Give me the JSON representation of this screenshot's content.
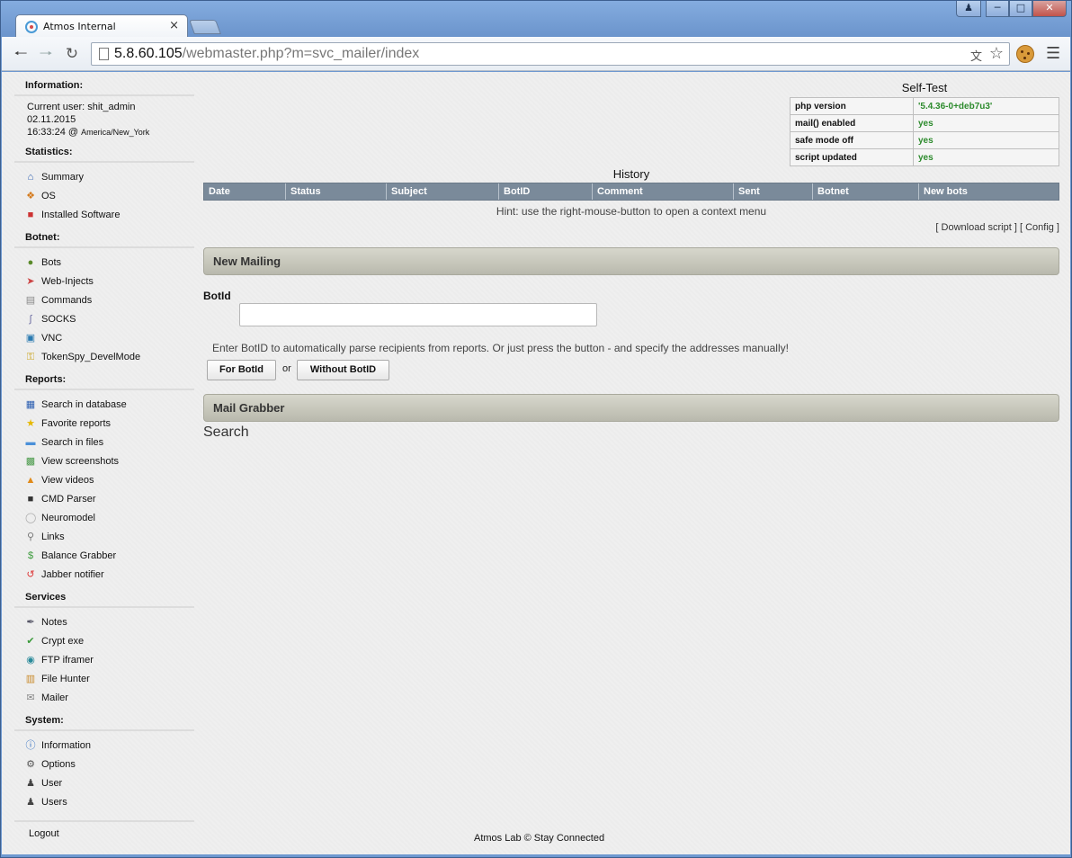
{
  "browser": {
    "tab_title": "Atmos Internal",
    "tab_close": "×",
    "url_host": "5.8.60.105",
    "url_path": "/webmaster.php?m=svc_mailer/index"
  },
  "sidebar": {
    "information_title": "Information:",
    "current_user": "Current user: shit_admin",
    "date": "02.11.2015",
    "time": "16:33:24 @",
    "timezone": "America/New_York",
    "statistics_title": "Statistics:",
    "statistics": [
      {
        "label": "Summary",
        "icon": "home-icon"
      },
      {
        "label": "OS",
        "icon": "windows-icon"
      },
      {
        "label": "Installed Software",
        "icon": "software-icon"
      }
    ],
    "botnet_title": "Botnet:",
    "botnet": [
      {
        "label": "Bots",
        "icon": "bot-icon"
      },
      {
        "label": "Web-Injects",
        "icon": "inject-icon"
      },
      {
        "label": "Commands",
        "icon": "clipboard-icon"
      },
      {
        "label": "SOCKS",
        "icon": "socks-icon"
      },
      {
        "label": "VNC",
        "icon": "monitor-icon"
      },
      {
        "label": "TokenSpy_DevelMode",
        "icon": "key-icon"
      }
    ],
    "reports_title": "Reports:",
    "reports": [
      {
        "label": "Search in database",
        "icon": "database-icon"
      },
      {
        "label": "Favorite reports",
        "icon": "star-icon"
      },
      {
        "label": "Search in files",
        "icon": "folder-icon"
      },
      {
        "label": "View screenshots",
        "icon": "screenshot-icon"
      },
      {
        "label": "View videos",
        "icon": "video-icon"
      },
      {
        "label": "CMD Parser",
        "icon": "cmd-icon"
      },
      {
        "label": "Neuromodel",
        "icon": "neuro-icon"
      },
      {
        "label": "Links",
        "icon": "magnifier-icon"
      },
      {
        "label": "Balance Grabber",
        "icon": "dollar-icon"
      },
      {
        "label": "Jabber notifier",
        "icon": "jabber-icon"
      }
    ],
    "services_title": "Services",
    "services": [
      {
        "label": "Notes",
        "icon": "pen-icon"
      },
      {
        "label": "Crypt exe",
        "icon": "shield-icon"
      },
      {
        "label": "FTP iframer",
        "icon": "ftp-icon"
      },
      {
        "label": "File Hunter",
        "icon": "chart-icon"
      },
      {
        "label": "Mailer",
        "icon": "mail-icon"
      }
    ],
    "system_title": "System:",
    "system": [
      {
        "label": "Information",
        "icon": "info-icon"
      },
      {
        "label": "Options",
        "icon": "gear-icon"
      },
      {
        "label": "User",
        "icon": "user-icon"
      },
      {
        "label": "Users",
        "icon": "users-icon"
      }
    ],
    "logout": "Logout"
  },
  "selftest": {
    "title": "Self-Test",
    "rows": [
      {
        "key": "php version",
        "value": "'5.4.36-0+deb7u3'"
      },
      {
        "key": "mail() enabled",
        "value": "yes"
      },
      {
        "key": "safe mode off",
        "value": "yes"
      },
      {
        "key": "script updated",
        "value": "yes"
      }
    ]
  },
  "history": {
    "title": "History",
    "columns": [
      "Date",
      "Status",
      "Subject",
      "BotID",
      "Comment",
      "Sent",
      "Botnet",
      "New bots"
    ],
    "hint": "Hint: use the right-mouse-button to open a context menu",
    "download_link": "[ Download script ]",
    "config_link": "[ Config ]"
  },
  "new_mailing": {
    "title": "New Mailing",
    "botid_label": "BotId",
    "botid_value": "",
    "instructions": "Enter BotID to automatically parse recipients from reports. Or just press the button - and specify the addresses manually!",
    "for_botid_button": "For BotId",
    "or_text": "or",
    "without_botid_button": "Without BotID"
  },
  "mail_grabber": {
    "title": "Mail Grabber",
    "search_label": "Search"
  },
  "footer": "Atmos Lab © Stay Connected"
}
